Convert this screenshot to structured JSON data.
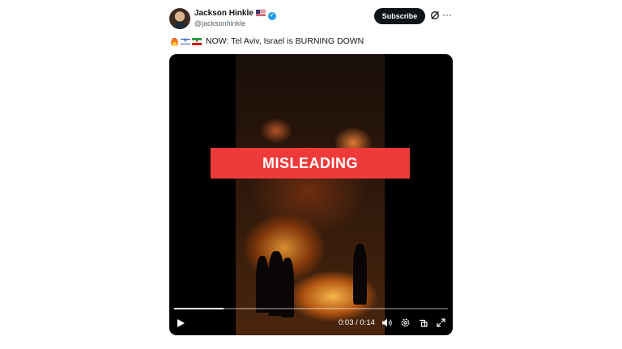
{
  "author": {
    "name": "Jackson Hinkle",
    "handle": "@jacksonhinkle",
    "flag_icon": "us-flag-icon",
    "verified_icon": "verified-badge-icon"
  },
  "actions": {
    "subscribe_label": "Subscribe",
    "grok_icon": "grok-icon",
    "more_label": "···"
  },
  "tweet": {
    "emojis": [
      "fire-emoji",
      "israel-flag-emoji",
      "iran-flag-emoji"
    ],
    "text": "NOW: Tel Aviv, Israel is BURNING DOWN"
  },
  "video": {
    "overlay_label": "MISLEADING",
    "overlay_color": "#ef3a3a",
    "current_time": "0:03",
    "duration": "0:14",
    "time_display": "0:03 / 0:14",
    "progress": 0.18,
    "controls": [
      "play-icon",
      "volume-icon",
      "settings-icon",
      "pip-icon",
      "fullscreen-icon"
    ]
  },
  "colors": {
    "subscribe_bg": "#0f1419",
    "verified": "#1d9bf0",
    "handle_text": "#536471"
  }
}
